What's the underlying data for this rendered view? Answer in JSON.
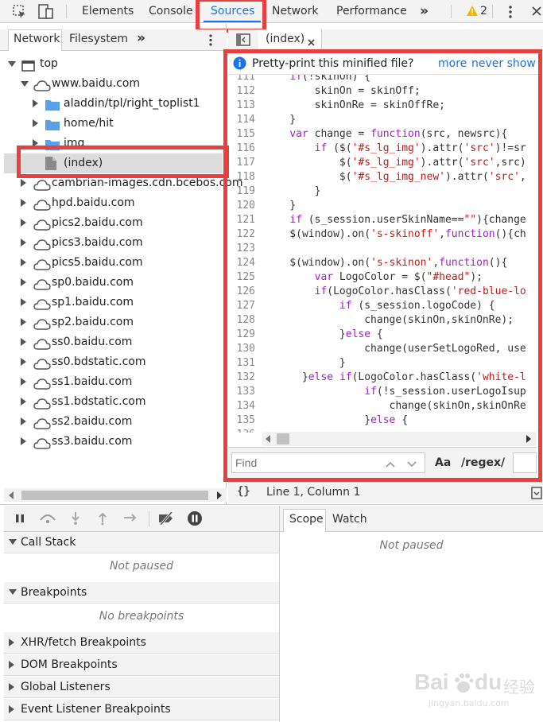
{
  "toolbar": {
    "tabs": [
      "Elements",
      "Console",
      "Sources",
      "Network",
      "Performance"
    ],
    "more_tabs": "»",
    "warning_count": "2"
  },
  "navigator": {
    "tabs": [
      "Network",
      "Filesystem"
    ],
    "more": "»",
    "tree": [
      {
        "label": "top",
        "depth": 0,
        "icon": "frame-icon",
        "expanded": true
      },
      {
        "label": "www.baidu.com",
        "depth": 1,
        "icon": "cloud-icon",
        "expanded": true
      },
      {
        "label": "aladdin/tpl/right_toplist1",
        "depth": 2,
        "icon": "folder-icon",
        "expanded": false
      },
      {
        "label": "home/hit",
        "depth": 2,
        "icon": "folder-icon",
        "expanded": false
      },
      {
        "label": "img",
        "depth": 2,
        "icon": "folder-icon",
        "expanded": false
      },
      {
        "label": "(index)",
        "depth": 3,
        "icon": "file-icon",
        "selected": true
      },
      {
        "label": "cambrian-images.cdn.bcebos.com",
        "depth": 1,
        "icon": "cloud-icon",
        "expanded": false
      },
      {
        "label": "hpd.baidu.com",
        "depth": 1,
        "icon": "cloud-icon",
        "expanded": false
      },
      {
        "label": "pics2.baidu.com",
        "depth": 1,
        "icon": "cloud-icon",
        "expanded": false
      },
      {
        "label": "pics3.baidu.com",
        "depth": 1,
        "icon": "cloud-icon",
        "expanded": false
      },
      {
        "label": "pics5.baidu.com",
        "depth": 1,
        "icon": "cloud-icon",
        "expanded": false
      },
      {
        "label": "sp0.baidu.com",
        "depth": 1,
        "icon": "cloud-icon",
        "expanded": false
      },
      {
        "label": "sp1.baidu.com",
        "depth": 1,
        "icon": "cloud-icon",
        "expanded": false
      },
      {
        "label": "sp2.baidu.com",
        "depth": 1,
        "icon": "cloud-icon",
        "expanded": false
      },
      {
        "label": "ss0.baidu.com",
        "depth": 1,
        "icon": "cloud-icon",
        "expanded": false
      },
      {
        "label": "ss0.bdstatic.com",
        "depth": 1,
        "icon": "cloud-icon",
        "expanded": false
      },
      {
        "label": "ss1.baidu.com",
        "depth": 1,
        "icon": "cloud-icon",
        "expanded": false
      },
      {
        "label": "ss1.bdstatic.com",
        "depth": 1,
        "icon": "cloud-icon",
        "expanded": false
      },
      {
        "label": "ss2.baidu.com",
        "depth": 1,
        "icon": "cloud-icon",
        "expanded": false
      },
      {
        "label": "ss3.baidu.com",
        "depth": 1,
        "icon": "cloud-icon",
        "expanded": false
      }
    ]
  },
  "editor": {
    "file_tab": "(index)",
    "infobar": {
      "message": "Pretty-print this minified file?",
      "more_link": "more",
      "never_link": "never show"
    },
    "code_lines": [
      {
        "n": "111",
        "text": "    if(!skinOn) {"
      },
      {
        "n": "112",
        "text": "        skinOn = skinOff;"
      },
      {
        "n": "113",
        "text": "        skinOnRe = skinOffRe;"
      },
      {
        "n": "114",
        "text": "    }"
      },
      {
        "n": "115",
        "text": "    var change = function(src, newsrc){"
      },
      {
        "n": "116",
        "text": "        if ($('#s_lg_img').attr('src')!=sr"
      },
      {
        "n": "117",
        "text": "            $('#s_lg_img').attr('src',src)"
      },
      {
        "n": "118",
        "text": "            $('#s_lg_img_new').attr('src',"
      },
      {
        "n": "119",
        "text": "        }"
      },
      {
        "n": "120",
        "text": "    }"
      },
      {
        "n": "121",
        "text": "    if (s_session.userSkinName==\"\"){change"
      },
      {
        "n": "122",
        "text": "    $(window).on('s-skinoff',function(){ch"
      },
      {
        "n": "123",
        "text": ""
      },
      {
        "n": "124",
        "text": "    $(window).on('s-skinon',function(){"
      },
      {
        "n": "125",
        "text": "        var LogoColor = $(\"#head\");"
      },
      {
        "n": "126",
        "text": "        if(LogoColor.hasClass('red-blue-lo"
      },
      {
        "n": "127",
        "text": "            if (s_session.logoCode) {"
      },
      {
        "n": "128",
        "text": "                change(skinOn,skinOnRe);"
      },
      {
        "n": "129",
        "text": "            }else {"
      },
      {
        "n": "130",
        "text": "                change(userSetLogoRed, use"
      },
      {
        "n": "131",
        "text": "            }"
      },
      {
        "n": "132",
        "text": "      }else if(LogoColor.hasClass('white-l"
      },
      {
        "n": "133",
        "text": "                if(!s_session.userLogoIsup"
      },
      {
        "n": "134",
        "text": "                    change(skinOn,skinOnRe"
      },
      {
        "n": "135",
        "text": "                }else {"
      },
      {
        "n": "136",
        "text": ""
      }
    ],
    "find_placeholder": "Find",
    "find_case": "Aa",
    "find_regex": "/regex/",
    "status": "Line 1, Column 1",
    "status_icon": "{}"
  },
  "debugger": {
    "sections": [
      {
        "label": "Call Stack",
        "expanded": true,
        "placeholder": "Not paused"
      },
      {
        "label": "Breakpoints",
        "expanded": true,
        "placeholder": "No breakpoints"
      },
      {
        "label": "XHR/fetch Breakpoints",
        "expanded": false
      },
      {
        "label": "DOM Breakpoints",
        "expanded": false
      },
      {
        "label": "Global Listeners",
        "expanded": false
      },
      {
        "label": "Event Listener Breakpoints",
        "expanded": false
      }
    ],
    "right_tabs": [
      "Scope",
      "Watch"
    ],
    "scope_placeholder": "Not paused"
  },
  "watermark": {
    "brand": "Bai",
    "brand2": "du",
    "cn": "经验",
    "url": "jingyan.baidu.com"
  },
  "colors": {
    "highlight_red": "#e8403f",
    "accent_blue": "#1a73e8",
    "keyword_purple": "#a61ccf",
    "string_red": "#c41a16"
  }
}
